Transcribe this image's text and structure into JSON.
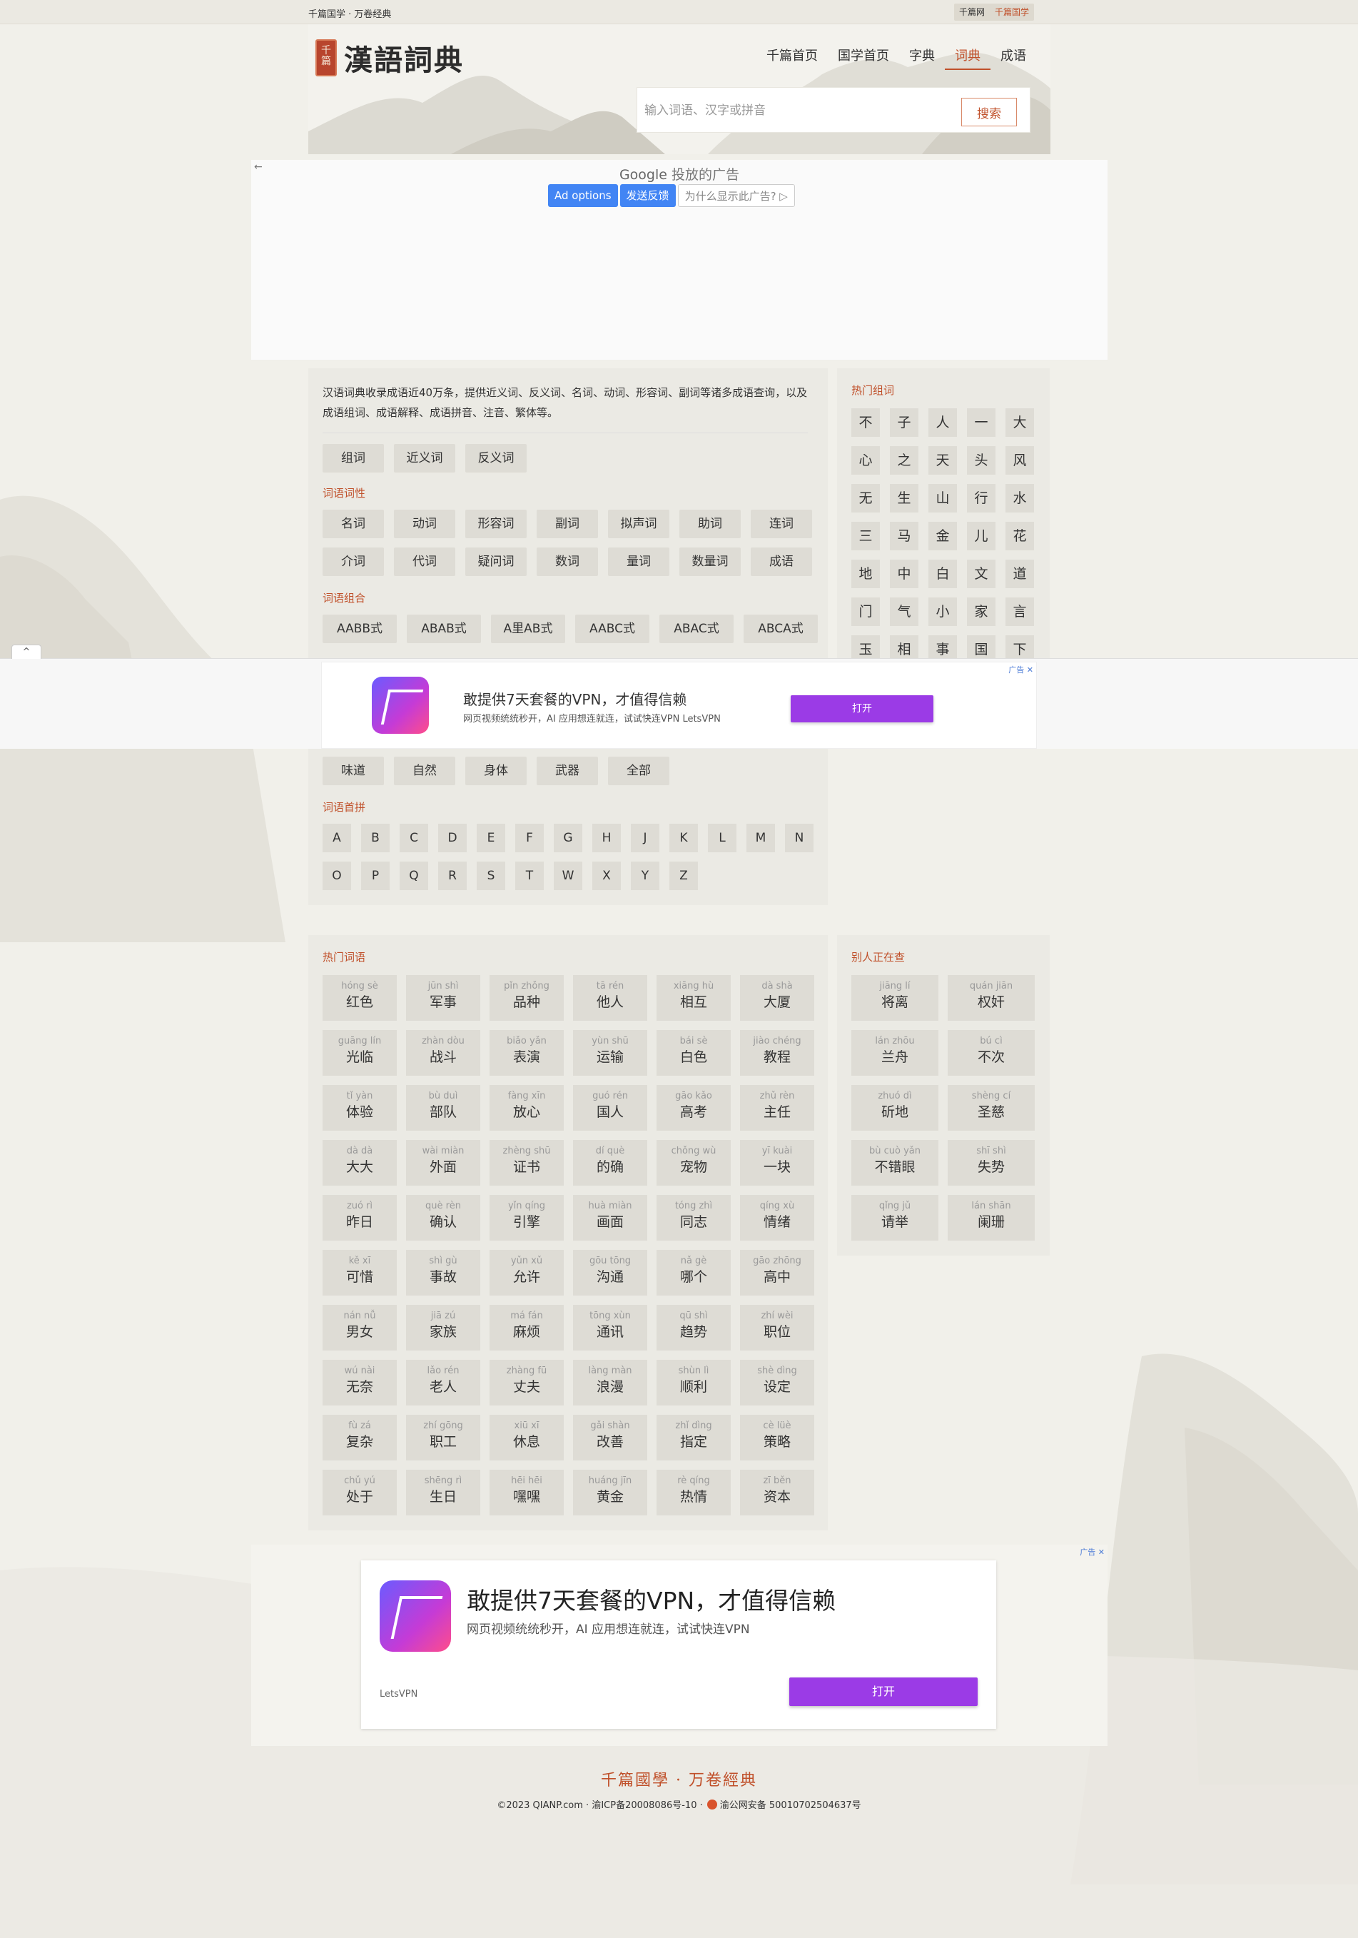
{
  "topbar": {
    "brand": "千篇国学 · 万卷经典",
    "tag1": "千篇网",
    "tag2": "千篇国学"
  },
  "logo": {
    "seal": "千篇",
    "title": "漢語詞典"
  },
  "nav": [
    "千篇首页",
    "国学首页",
    "字典",
    "词典",
    "成语"
  ],
  "nav_active": "词典",
  "search": {
    "placeholder": "输入词语、汉字或拼音",
    "button": "搜索"
  },
  "google_ad": {
    "back": "←",
    "label_google": "Google",
    "label_rest": "投放的广告",
    "ad_options": "Ad options",
    "feedback": "发送反馈",
    "why": "为什么显示此广告? ▷"
  },
  "intro": {
    "desc": "汉语词典收录成语近40万条，提供近义词、反义词、名词、动词、形容词、副词等诸多成语查询，以及成语组词、成语解释、成语拼音、注音、繁体等。",
    "main_tags": [
      "组词",
      "近义词",
      "反义词"
    ],
    "pos_title": "词语词性",
    "pos_row1": [
      "名词",
      "动词",
      "形容词",
      "副词",
      "拟声词",
      "助词",
      "连词"
    ],
    "pos_row2": [
      "介词",
      "代词",
      "疑问词",
      "数词",
      "量词",
      "数量词",
      "成语"
    ],
    "combo_title": "词语组合",
    "combo": [
      "AABB式",
      "ABAB式",
      "A里AB式",
      "AABC式",
      "ABAC式",
      "ABCA式"
    ],
    "theme_tags": [
      "味道",
      "自然",
      "身体",
      "武器",
      "全部"
    ],
    "initial_title": "词语首拼",
    "letters_row1": [
      "A",
      "B",
      "C",
      "D",
      "E",
      "F",
      "G",
      "H",
      "J",
      "K",
      "L",
      "M",
      "N"
    ],
    "letters_row2": [
      "O",
      "P",
      "Q",
      "R",
      "S",
      "T",
      "W",
      "X",
      "Y",
      "Z"
    ]
  },
  "hot_chars": {
    "title": "热门组词",
    "chars": [
      "不",
      "子",
      "人",
      "一",
      "大",
      "心",
      "之",
      "天",
      "头",
      "风",
      "无",
      "生",
      "山",
      "行",
      "水",
      "三",
      "马",
      "金",
      "儿",
      "花",
      "地",
      "中",
      "白",
      "文",
      "道",
      "门",
      "气",
      "小",
      "家",
      "言",
      "玉",
      "相",
      "事",
      "国",
      "下"
    ]
  },
  "ad_band": {
    "collapse": "^",
    "title": "敢提供7天套餐的VPN，才值得信赖",
    "subtitle": "网页视频统统秒开，AI 应用想连就连，试试快连VPN LetsVPN",
    "button": "打开",
    "mark": "广告 ✕"
  },
  "hot_words": {
    "title": "热门词语",
    "items": [
      {
        "py": "hóng sè",
        "hz": "红色"
      },
      {
        "py": "jūn shì",
        "hz": "军事"
      },
      {
        "py": "pǐn zhǒng",
        "hz": "品种"
      },
      {
        "py": "tā rén",
        "hz": "他人"
      },
      {
        "py": "xiāng hù",
        "hz": "相互"
      },
      {
        "py": "dà shà",
        "hz": "大厦"
      },
      {
        "py": "guāng lín",
        "hz": "光临"
      },
      {
        "py": "zhàn dòu",
        "hz": "战斗"
      },
      {
        "py": "biǎo yǎn",
        "hz": "表演"
      },
      {
        "py": "yùn shū",
        "hz": "运输"
      },
      {
        "py": "bái sè",
        "hz": "白色"
      },
      {
        "py": "jiào chéng",
        "hz": "教程"
      },
      {
        "py": "tǐ yàn",
        "hz": "体验"
      },
      {
        "py": "bù duì",
        "hz": "部队"
      },
      {
        "py": "fàng xīn",
        "hz": "放心"
      },
      {
        "py": "guó rén",
        "hz": "国人"
      },
      {
        "py": "gāo kǎo",
        "hz": "高考"
      },
      {
        "py": "zhǔ rèn",
        "hz": "主任"
      },
      {
        "py": "dà dà",
        "hz": "大大"
      },
      {
        "py": "wài miàn",
        "hz": "外面"
      },
      {
        "py": "zhèng shū",
        "hz": "证书"
      },
      {
        "py": "dí què",
        "hz": "的确"
      },
      {
        "py": "chǒng wù",
        "hz": "宠物"
      },
      {
        "py": "yī kuài",
        "hz": "一块"
      },
      {
        "py": "zuó rì",
        "hz": "昨日"
      },
      {
        "py": "què rèn",
        "hz": "确认"
      },
      {
        "py": "yǐn qíng",
        "hz": "引擎"
      },
      {
        "py": "huà miàn",
        "hz": "画面"
      },
      {
        "py": "tóng zhì",
        "hz": "同志"
      },
      {
        "py": "qíng xù",
        "hz": "情绪"
      },
      {
        "py": "kě xī",
        "hz": "可惜"
      },
      {
        "py": "shì gù",
        "hz": "事故"
      },
      {
        "py": "yǔn xǔ",
        "hz": "允许"
      },
      {
        "py": "gōu tōng",
        "hz": "沟通"
      },
      {
        "py": "nǎ gè",
        "hz": "哪个"
      },
      {
        "py": "gāo zhōng",
        "hz": "高中"
      },
      {
        "py": "nán nǚ",
        "hz": "男女"
      },
      {
        "py": "jiā zú",
        "hz": "家族"
      },
      {
        "py": "má fán",
        "hz": "麻烦"
      },
      {
        "py": "tōng xùn",
        "hz": "通讯"
      },
      {
        "py": "qū shì",
        "hz": "趋势"
      },
      {
        "py": "zhí wèi",
        "hz": "职位"
      },
      {
        "py": "wú nài",
        "hz": "无奈"
      },
      {
        "py": "lǎo rén",
        "hz": "老人"
      },
      {
        "py": "zhàng fū",
        "hz": "丈夫"
      },
      {
        "py": "làng màn",
        "hz": "浪漫"
      },
      {
        "py": "shùn lì",
        "hz": "顺利"
      },
      {
        "py": "shè dìng",
        "hz": "设定"
      },
      {
        "py": "fù zá",
        "hz": "复杂"
      },
      {
        "py": "zhí gōng",
        "hz": "职工"
      },
      {
        "py": "xiū xī",
        "hz": "休息"
      },
      {
        "py": "gǎi shàn",
        "hz": "改善"
      },
      {
        "py": "zhǐ dìng",
        "hz": "指定"
      },
      {
        "py": "cè lüè",
        "hz": "策略"
      },
      {
        "py": "chǔ yú",
        "hz": "处于"
      },
      {
        "py": "shēng rì",
        "hz": "生日"
      },
      {
        "py": "hēi hēi",
        "hz": "嘿嘿"
      },
      {
        "py": "huáng jīn",
        "hz": "黄金"
      },
      {
        "py": "rè qíng",
        "hz": "热情"
      },
      {
        "py": "zī běn",
        "hz": "资本"
      }
    ]
  },
  "others": {
    "title": "别人正在查",
    "items": [
      {
        "py": "jiāng lí",
        "hz": "将离"
      },
      {
        "py": "quán jiān",
        "hz": "权奸"
      },
      {
        "py": "lán zhōu",
        "hz": "兰舟"
      },
      {
        "py": "bú cì",
        "hz": "不次"
      },
      {
        "py": "zhuó dì",
        "hz": "斫地"
      },
      {
        "py": "shèng cí",
        "hz": "圣慈"
      },
      {
        "py": "bù cuò yǎn",
        "hz": "不错眼"
      },
      {
        "py": "shī shì",
        "hz": "失势"
      },
      {
        "py": "qǐng jǔ",
        "hz": "请举"
      },
      {
        "py": "lán shān",
        "hz": "阑珊"
      }
    ]
  },
  "ad2": {
    "title": "敢提供7天套餐的VPN，才值得信赖",
    "subtitle": "网页视频统统秒开，AI 应用想连就连，试试快连VPN",
    "brand": "LetsVPN",
    "button": "打开",
    "mark": "广告 ✕"
  },
  "footer": {
    "logo": "千篇國學 · 万卷經典",
    "copyright": "©2023 QIANP.com · 渝ICP备20008086号-10 ·",
    "police": "渝公网安备 50010702504637号"
  },
  "colors": {
    "accent": "#c0502a",
    "page_bg": "#f1f0ea",
    "panel_bg": "#ebeae4",
    "cell_bg": "#dedcd5",
    "ad_button": "#9b3be6",
    "ad_options": "#4285f4"
  }
}
